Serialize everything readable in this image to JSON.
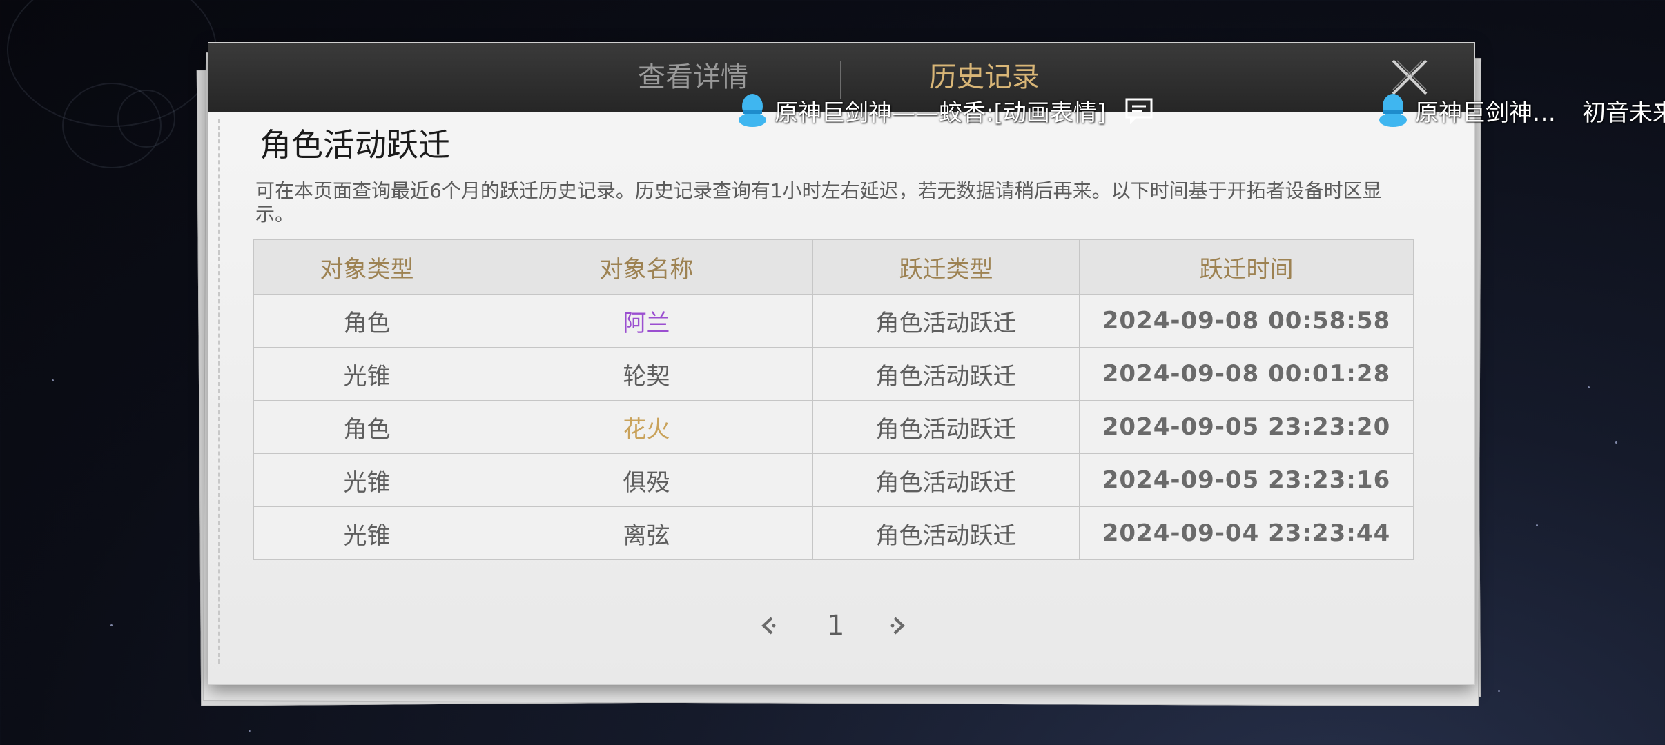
{
  "tabs": {
    "details": "查看详情",
    "history": "历史记录"
  },
  "section": {
    "title": "角色活动跃迁",
    "description": "可在本页面查询最近6个月的跃迁历史记录。历史记录查询有1小时左右延迟，若无数据请稍后再来。以下时间基于开拓者设备时区显示。"
  },
  "table": {
    "headers": [
      "对象类型",
      "对象名称",
      "跃迁类型",
      "跃迁时间"
    ],
    "rows": [
      {
        "type": "角色",
        "name": "阿兰",
        "name_color": "#9b4fd0",
        "warp": "角色活动跃迁",
        "time": "2024-09-08 00:58:58"
      },
      {
        "type": "光锥",
        "name": "轮契",
        "name_color": "#5e5e5e",
        "warp": "角色活动跃迁",
        "time": "2024-09-08 00:01:28"
      },
      {
        "type": "角色",
        "name": "花火",
        "name_color": "#c9a25a",
        "warp": "角色活动跃迁",
        "time": "2024-09-05 23:23:20"
      },
      {
        "type": "光锥",
        "name": "俱殁",
        "name_color": "#5e5e5e",
        "warp": "角色活动跃迁",
        "time": "2024-09-05 23:23:16"
      },
      {
        "type": "光锥",
        "name": "离弦",
        "name_color": "#5e5e5e",
        "warp": "角色活动跃迁",
        "time": "2024-09-04 23:23:44"
      }
    ]
  },
  "pager": {
    "current_page": "1"
  },
  "danmaku": [
    {
      "text": "原神巨剑神——蛟香:[动画表情]"
    },
    {
      "text": "原神巨剑神…"
    },
    {
      "text": "初音未来"
    }
  ],
  "colors": {
    "accent_gold": "#d9b677",
    "header_gold": "#9d8252",
    "purple_rarity": "#9b4fd0",
    "gold_rarity": "#c9a25a"
  }
}
